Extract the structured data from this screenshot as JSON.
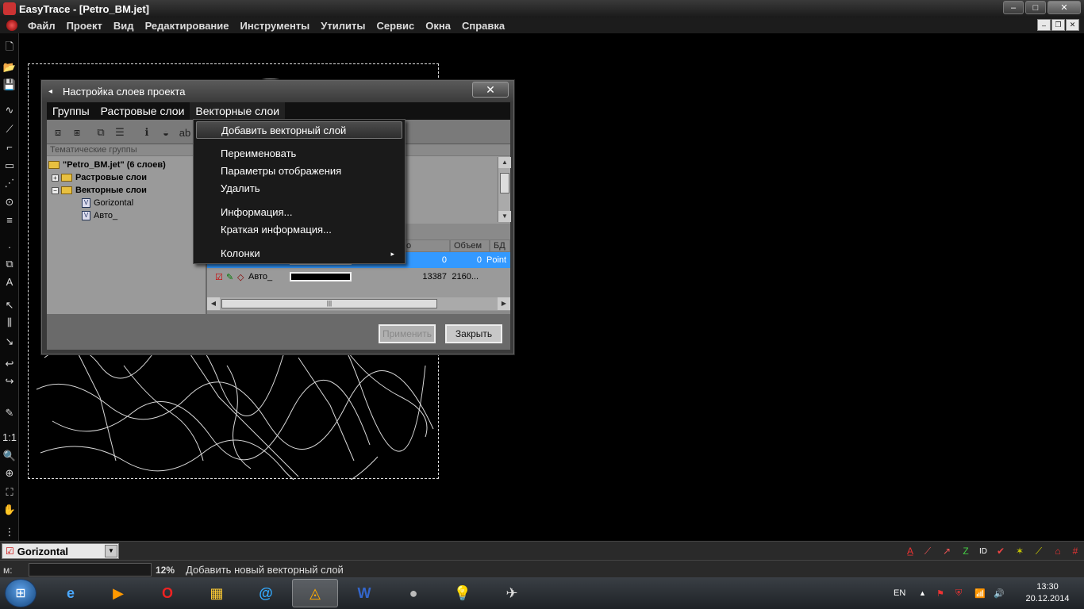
{
  "window": {
    "title": "EasyTrace - [Petro_BM.jet]",
    "buttons": {
      "minimize": "–",
      "maximize": "□",
      "close": "✕"
    }
  },
  "menubar": {
    "items": [
      "Файл",
      "Проект",
      "Вид",
      "Редактирование",
      "Инструменты",
      "Утилиты",
      "Сервис",
      "Окна",
      "Справка"
    ],
    "mdi": {
      "minimize": "–",
      "restore": "❐",
      "close": "✕"
    }
  },
  "dialog": {
    "title": "Настройка слоев проекта",
    "close": "✕",
    "menu": [
      "Группы",
      "Растровые слои",
      "Векторные слои"
    ],
    "tree": {
      "header": "Тематические группы",
      "root": "\"Petro_BM.jet\" (6 слоев)",
      "raster_group": "Растровые слои",
      "vector_group": "Векторные слои",
      "layers": [
        "Gorizontal",
        "Авто_"
      ]
    },
    "table": {
      "columns": [
        "о объектов",
        "Объем",
        "БД"
      ],
      "rows": [
        {
          "name": "",
          "objects": "0",
          "volume": "0",
          "db": "Point"
        },
        {
          "name": "Авто_",
          "objects": "13387",
          "volume": "2160...",
          "db": ""
        }
      ]
    },
    "buttons": {
      "apply": "Применить",
      "close": "Закрыть"
    }
  },
  "dropdown": {
    "items": [
      "Добавить векторный слой",
      "Переименовать",
      "Параметры отображения",
      "Удалить",
      "Информация...",
      "Краткая информация...",
      "Колонки"
    ],
    "submenu_arrow": "▸"
  },
  "layerbar": {
    "current_layer": "Gorizontal"
  },
  "statusbar": {
    "m_label": "м:",
    "zoom": "12%",
    "message": "Добавить новый векторный слой"
  },
  "taskbar": {
    "language": "EN",
    "time": "13:30",
    "date": "20.12.2014"
  },
  "colors": {
    "highlight": "#3399ff",
    "menu_bg": "#1a1a1a",
    "dialog_bg": "#6a6a6a"
  }
}
